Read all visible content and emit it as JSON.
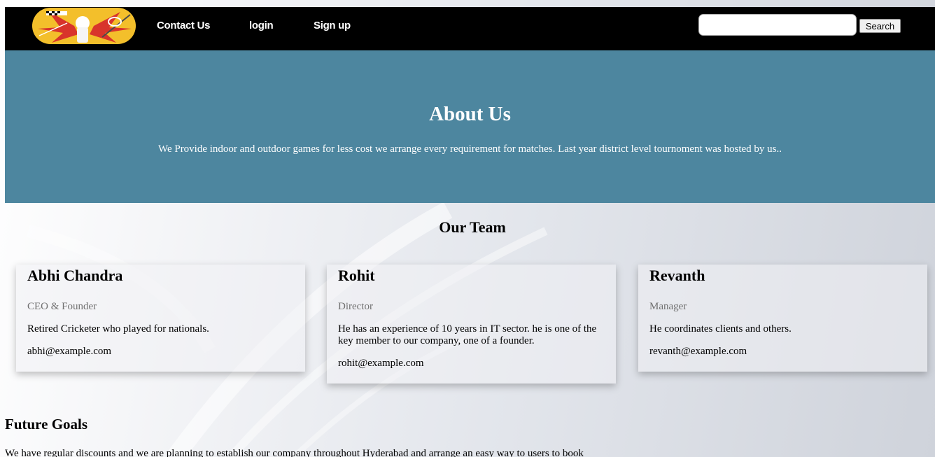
{
  "nav": {
    "links": [
      "Contact Us",
      "login",
      "Sign up"
    ],
    "search_placeholder": "",
    "search_button": "Search"
  },
  "hero": {
    "title": "About Us",
    "text": "We Provide indoor and outdoor games for less cost we arrange every requirement for matches. Last year district level tournoment was hosted by us.."
  },
  "team": {
    "heading": "Our Team",
    "members": [
      {
        "name": "Abhi Chandra",
        "role": "CEO & Founder",
        "description": "Retired Cricketer who played for nationals.",
        "email": "abhi@example.com"
      },
      {
        "name": "Rohit",
        "role": "Director",
        "description": "He has an experience of 10 years in IT sector. he is one of the key member to our company, one of a founder.",
        "email": "rohit@example.com"
      },
      {
        "name": "Revanth",
        "role": "Manager",
        "description": "He coordinates clients and others.",
        "email": "revanth@example.com"
      }
    ]
  },
  "goals": {
    "heading": "Future Goals",
    "text": "We have regular discounts and we are planning to establish our company throughout Hyderabad and arrange an easy way to users to book"
  },
  "colors": {
    "navbar": "#000000",
    "hero": "#4d869f",
    "logo_bg": "#f3bf2b"
  }
}
